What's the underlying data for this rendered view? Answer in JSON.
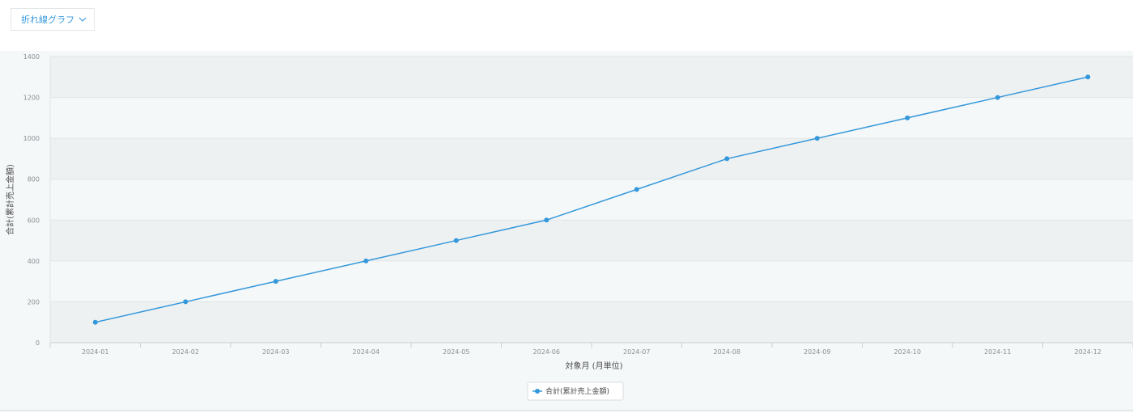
{
  "toolbar": {
    "chart_type_label": "折れ線グラフ",
    "chevron_icon": "chevron-down-icon"
  },
  "colors": {
    "series": "#3498db",
    "band_dark": "#eef1f2",
    "band_light": "#f5f8f9",
    "gridline": "#e1e5e7"
  },
  "chart_data": {
    "type": "line",
    "categories": [
      "2024-01",
      "2024-02",
      "2024-03",
      "2024-04",
      "2024-05",
      "2024-06",
      "2024-07",
      "2024-08",
      "2024-09",
      "2024-10",
      "2024-11",
      "2024-12"
    ],
    "series": [
      {
        "name": "合計(累計売上金額)",
        "values": [
          100,
          200,
          300,
          400,
          500,
          600,
          750,
          900,
          1000,
          1100,
          1200,
          1300
        ]
      }
    ],
    "xlabel": "対象月 (月単位)",
    "ylabel": "合計(累計売上金額)",
    "ylim": [
      0,
      1400
    ],
    "yticks": [
      0,
      200,
      400,
      600,
      800,
      1000,
      1200,
      1400
    ],
    "grid": true,
    "legend": "bottom-center"
  }
}
